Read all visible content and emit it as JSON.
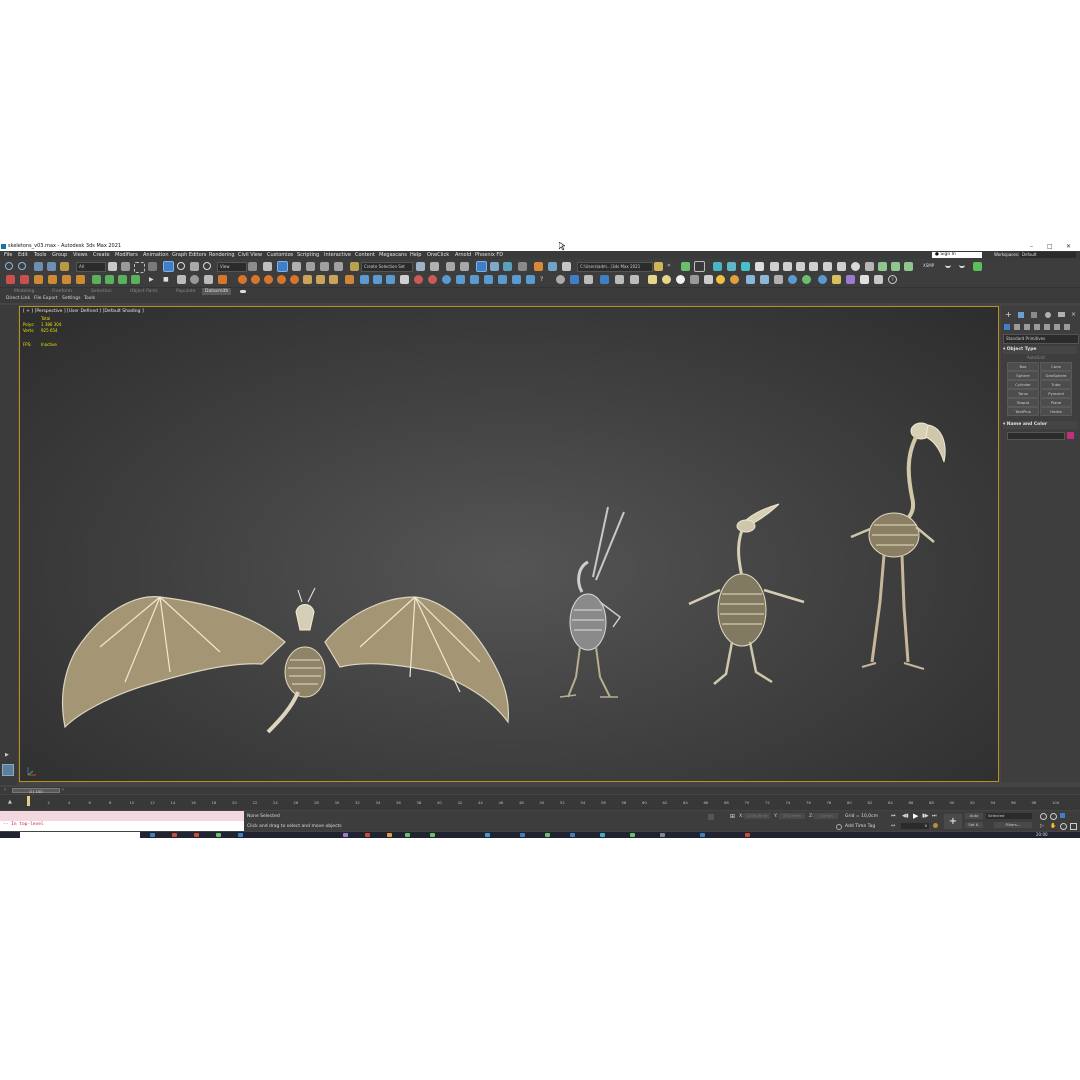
{
  "window": {
    "title": "skeletons_v03.max - Autodesk 3ds Max 2021",
    "controls": [
      "–",
      "□",
      "✕"
    ]
  },
  "menu": [
    "File",
    "Edit",
    "Tools",
    "Group",
    "Views",
    "Create",
    "Modifiers",
    "Animation",
    "Graph Editors",
    "Rendering",
    "Civil View",
    "Customize",
    "Scripting",
    "Interactive",
    "Content",
    "Megascans",
    "Help",
    "OneClick",
    "Arnold",
    "Phoenix FD"
  ],
  "account": {
    "signin": "Sign In",
    "workspaces_label": "Workspaces:",
    "workspace": "Default"
  },
  "toolbar": {
    "filter": "All",
    "view": "View",
    "selection_set": "Create Selection Set",
    "path": "C:\\Users\\adm...\\3ds Max 2021",
    "xsmp": "XSMP"
  },
  "ribbon_tabs": [
    "Modeling",
    "Freeform",
    "Selection",
    "Object Paint",
    "Populate",
    "Datasmith"
  ],
  "subbar": [
    "Direct Link",
    "File Export",
    "Settings",
    "Tools"
  ],
  "viewport": {
    "label": "[ + ] [Perspective ] [User Defined ] [Default Shading ]",
    "stats": {
      "total_label": "Total",
      "polys_label": "Polys:",
      "polys": "1 386 304",
      "verts_label": "Verts:",
      "verts": "925 654",
      "fps_label": "FPS:",
      "fps": "Inactive"
    }
  },
  "command_panel": {
    "category": "Standard Primitives",
    "object_type_title": "Object Type",
    "autogrid": "AutoGrid",
    "buttons": [
      "Box",
      "Cone",
      "Sphere",
      "GeoSphere",
      "Cylinder",
      "Tube",
      "Torus",
      "Pyramid",
      "Teapot",
      "Plane",
      "TextPlus",
      "Hedra"
    ],
    "name_color_title": "Name and Color",
    "color": "#c0307a"
  },
  "timeline": {
    "frame": "0 / 100",
    "ticks": [
      "0",
      "2",
      "4",
      "6",
      "8",
      "10",
      "12",
      "14",
      "16",
      "18",
      "20",
      "22",
      "24",
      "26",
      "28",
      "30",
      "32",
      "34",
      "36",
      "38",
      "40",
      "42",
      "44",
      "46",
      "48",
      "50",
      "52",
      "54",
      "56",
      "58",
      "60",
      "62",
      "64",
      "66",
      "68",
      "70",
      "72",
      "74",
      "76",
      "78",
      "80",
      "82",
      "84",
      "86",
      "88",
      "90",
      "92",
      "94",
      "96",
      "98",
      "100"
    ]
  },
  "status": {
    "script_line": "-- In top-level",
    "selection": "None Selected",
    "hint": "Click and drag to select and move objects",
    "x_label": "X:",
    "x": "1256,8mm",
    "y_label": "Y:",
    "y": "330,9mm",
    "z_label": "Z:",
    "z": "0,0mm",
    "grid": "Grid = 10,0cm",
    "add_time_tag": "Add Time Tag",
    "auto": "Auto",
    "setk": "Set K.",
    "selected": "Selected",
    "filters": "Filters...",
    "frame_value": "0",
    "clock": "20:00"
  }
}
